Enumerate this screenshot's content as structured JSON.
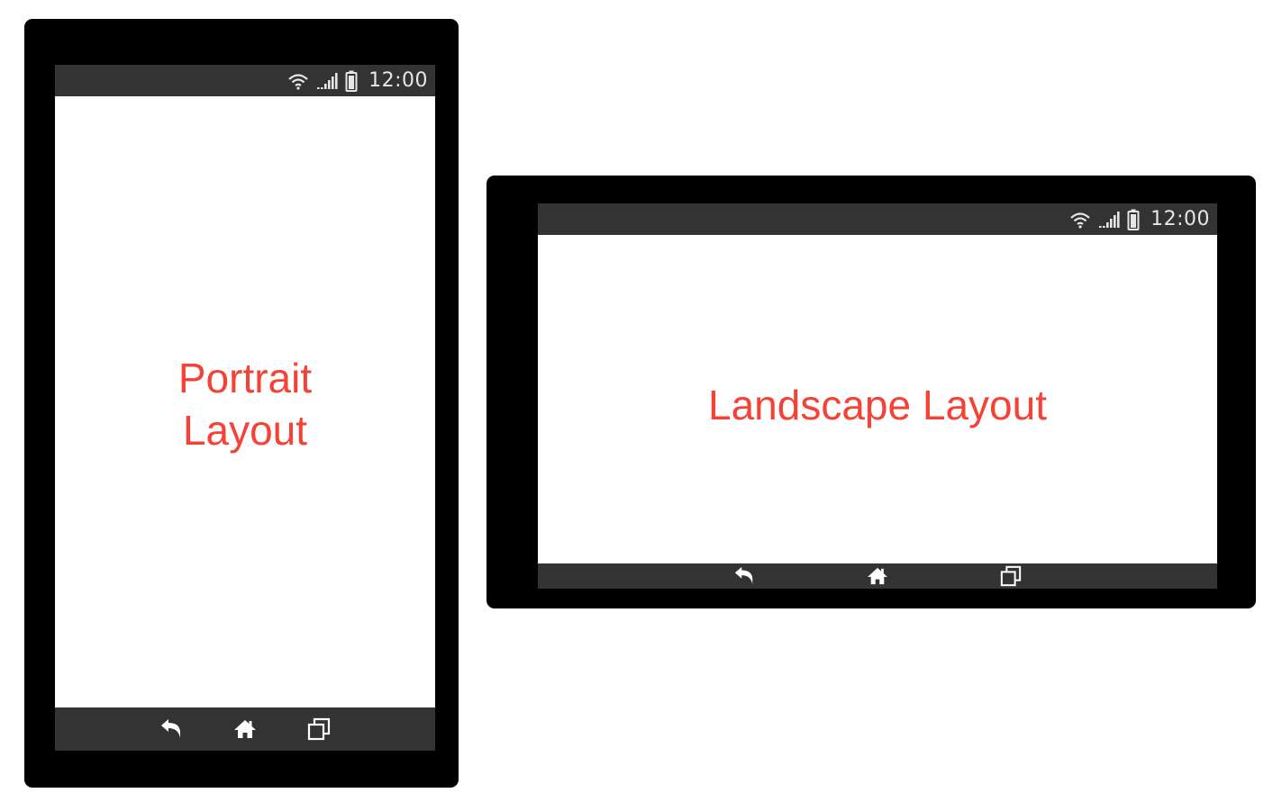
{
  "portrait": {
    "status_bar": {
      "time": "12:00",
      "icons": [
        "wifi-icon",
        "signal-icon",
        "battery-icon"
      ]
    },
    "label": "Portrait Layout",
    "nav_bar": {
      "buttons": [
        "back-icon",
        "home-icon",
        "recents-icon"
      ]
    }
  },
  "landscape": {
    "status_bar": {
      "time": "12:00",
      "icons": [
        "wifi-icon",
        "signal-icon",
        "battery-icon"
      ]
    },
    "label": "Landscape Layout",
    "nav_bar": {
      "buttons": [
        "back-icon",
        "home-icon",
        "recents-icon"
      ]
    }
  },
  "colors": {
    "device_frame": "#000000",
    "bar_background": "#333333",
    "screen_background": "#ffffff",
    "label_text": "#f44336",
    "icon": "#e6e6e6"
  }
}
